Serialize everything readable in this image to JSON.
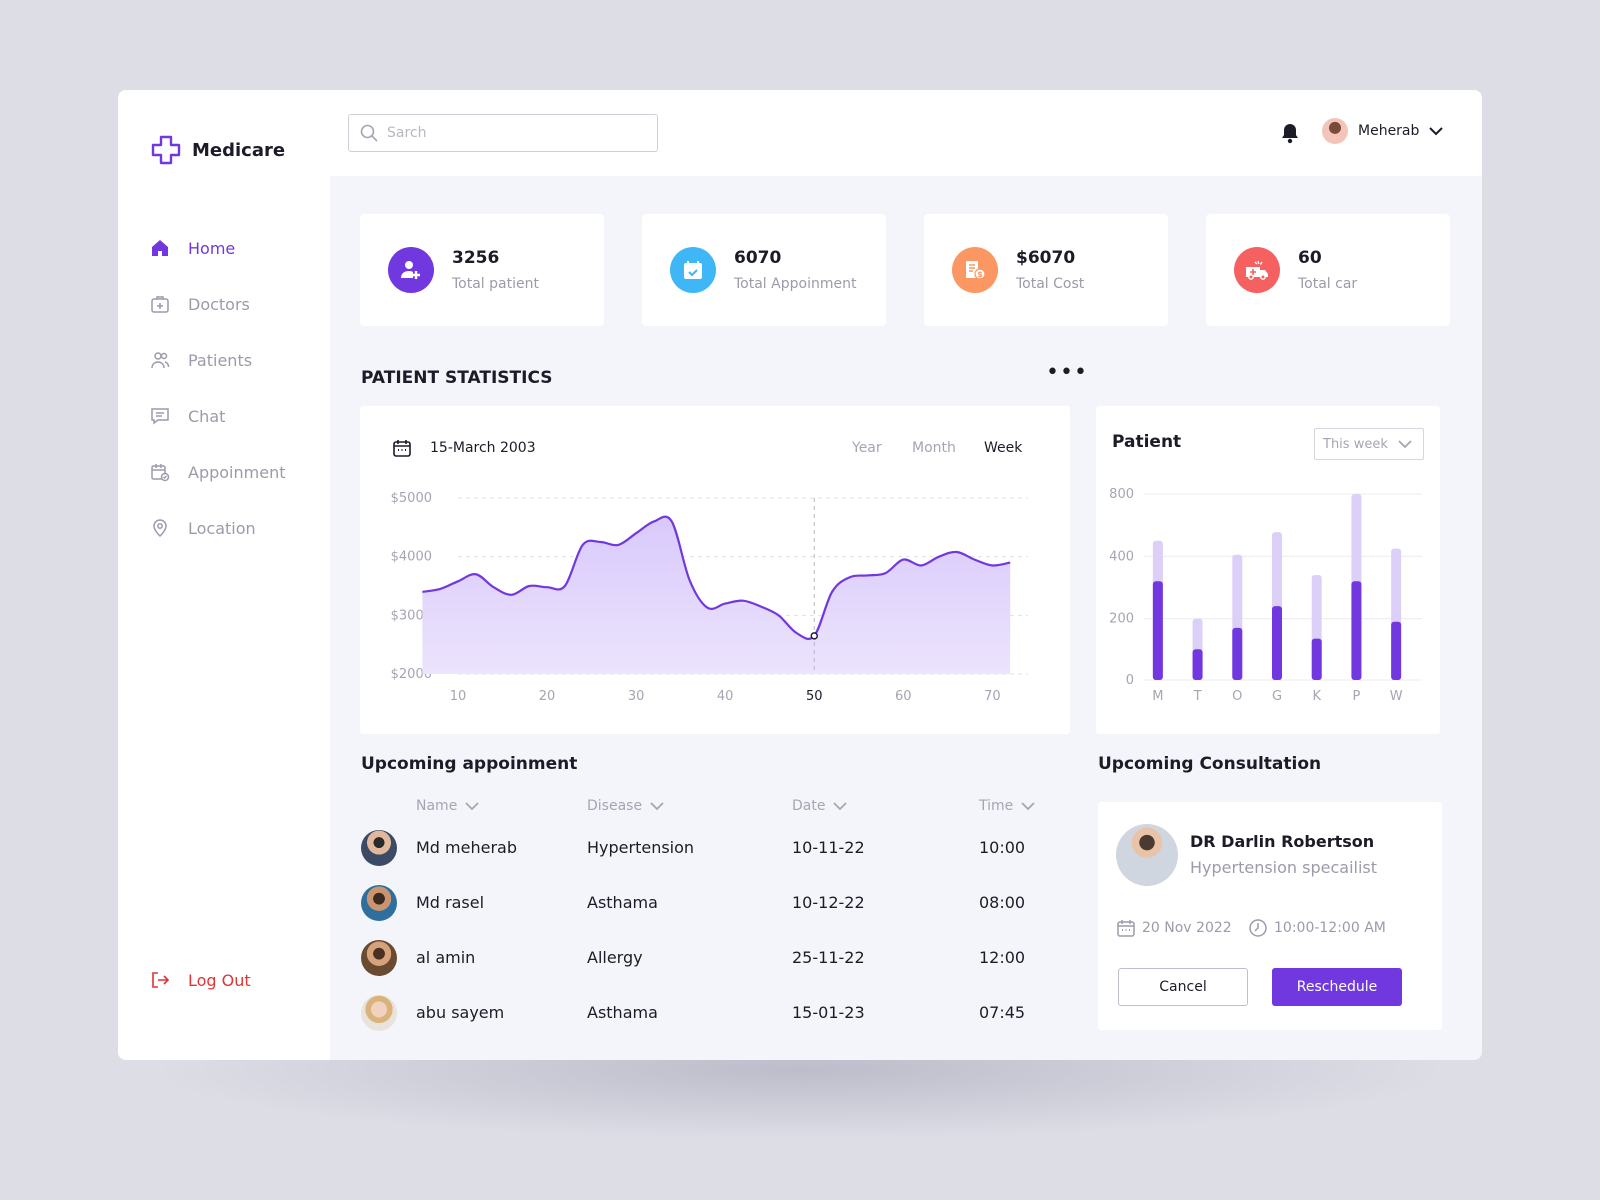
{
  "app": {
    "name": "Medicare",
    "accent": "#7138e0"
  },
  "search": {
    "placeholder": "Sarch"
  },
  "user": {
    "name": "Meherab"
  },
  "sidebar": {
    "items": [
      {
        "label": "Home",
        "icon": "home-icon",
        "active": true
      },
      {
        "label": "Doctors",
        "icon": "doctor-bag-icon"
      },
      {
        "label": "Patients",
        "icon": "users-icon"
      },
      {
        "label": "Chat",
        "icon": "chat-icon"
      },
      {
        "label": "Appoinment",
        "icon": "calendar-check-icon"
      },
      {
        "label": "Location",
        "icon": "location-pin-icon"
      }
    ],
    "logout": "Log Out"
  },
  "stats": [
    {
      "value": "3256",
      "label": "Total patient",
      "color": "#7138e0",
      "icon": "add-user-icon"
    },
    {
      "value": "6070",
      "label": "Total Appoinment",
      "color": "#3fb6f5",
      "icon": "calendar-icon"
    },
    {
      "value": "$6070",
      "label": "Total Cost",
      "color": "#fb9762",
      "icon": "cost-icon"
    },
    {
      "value": "60",
      "label": "Total car",
      "color": "#f56161",
      "icon": "ambulance-icon"
    }
  ],
  "statistics": {
    "title": "PATIENT STATISTICS",
    "date": "15-March 2003",
    "periods": [
      "Year",
      "Month",
      "Week"
    ],
    "active_period": "Week"
  },
  "chart_data": [
    {
      "type": "area",
      "x": [
        6,
        8,
        10,
        12,
        14,
        16,
        18,
        20,
        22,
        24,
        26,
        28,
        30,
        32,
        34,
        36,
        38,
        40,
        42,
        44,
        46,
        48,
        50,
        52,
        54,
        56,
        58,
        60,
        62,
        64,
        66,
        68,
        70,
        72
      ],
      "values": [
        3400,
        3450,
        3580,
        3700,
        3480,
        3350,
        3500,
        3480,
        3500,
        4200,
        4250,
        4200,
        4400,
        4600,
        4600,
        3600,
        3130,
        3200,
        3250,
        3150,
        3000,
        2700,
        2650,
        3400,
        3650,
        3680,
        3720,
        3950,
        3850,
        4000,
        4080,
        3950,
        3850,
        3900
      ],
      "yticks": [
        "$5000",
        "$4000",
        "$3000",
        "$2000"
      ],
      "xticks": [
        "10",
        "20",
        "30",
        "40",
        "50",
        "60",
        "70"
      ],
      "highlight_x": "50",
      "ylim": [
        2000,
        5000
      ],
      "xlim": [
        10,
        74
      ],
      "grid": true,
      "color": "#7138e0"
    },
    {
      "type": "bar",
      "title": "Patient",
      "categories": [
        "M",
        "T",
        "O",
        "G",
        "K",
        "P",
        "W"
      ],
      "yticks": [
        "800",
        "400",
        "200",
        "0"
      ],
      "series": [
        {
          "values": [
            500,
            200,
            410,
            555,
            340,
            800,
            450
          ],
          "color": "#dcd0f8"
        },
        {
          "values": [
            320,
            100,
            170,
            240,
            135,
            320,
            190
          ],
          "color": "#7138e0"
        }
      ]
    }
  ],
  "bar_panel": {
    "select": "This week"
  },
  "appointments": {
    "title": "Upcoming appoinment",
    "headers": [
      "Name",
      "Disease",
      "Date",
      "Time"
    ],
    "rows": [
      {
        "name": "Md meherab",
        "disease": "Hypertension",
        "date": "10-11-22",
        "time": "10:00"
      },
      {
        "name": "Md rasel",
        "disease": "Asthama",
        "date": "10-12-22",
        "time": "08:00"
      },
      {
        "name": "al amin",
        "disease": "Allergy",
        "date": "25-11-22",
        "time": "12:00"
      },
      {
        "name": "abu sayem",
        "disease": "Asthama",
        "date": "15-01-23",
        "time": "07:45"
      }
    ]
  },
  "consultation": {
    "title": "Upcoming Consultation",
    "doctor": "DR Darlin Robertson",
    "speciality": "Hypertension specailist",
    "date": "20 Nov 2022",
    "time": "10:00-12:00 AM",
    "cancel": "Cancel",
    "reschedule": "Reschedule"
  }
}
